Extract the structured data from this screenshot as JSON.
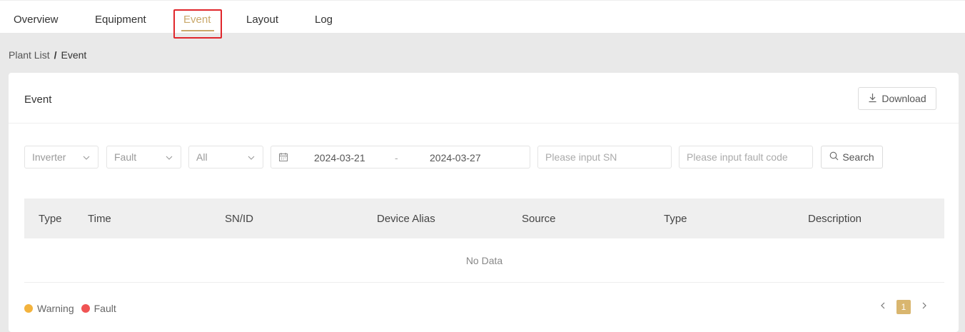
{
  "tabs": [
    {
      "label": "Overview"
    },
    {
      "label": "Equipment"
    },
    {
      "label": "Event"
    },
    {
      "label": "Layout"
    },
    {
      "label": "Log"
    }
  ],
  "breadcrumb": {
    "parent": "Plant List",
    "separator": "/",
    "current": "Event"
  },
  "card": {
    "title": "Event",
    "download_label": "Download"
  },
  "filters": {
    "device_type": "Inverter",
    "event_type": "Fault",
    "scope": "All",
    "date_start": "2024-03-21",
    "date_sep": "-",
    "date_end": "2024-03-27",
    "sn_placeholder": "Please input SN",
    "fault_code_placeholder": "Please input fault code",
    "search_label": "Search"
  },
  "table": {
    "columns": [
      "Type",
      "Time",
      "SN/ID",
      "Device Alias",
      "Source",
      "Type",
      "Description"
    ],
    "empty_text": "No Data"
  },
  "legend": {
    "warning": "Warning",
    "fault": "Fault"
  },
  "pagination": {
    "current_page": "1"
  },
  "colors": {
    "accent": "#c9a86a",
    "warning": "#f3b33d",
    "fault": "#f05454",
    "highlight": "#e0262b"
  },
  "icons": [
    "download-icon",
    "chevron-down-icon",
    "calendar-icon",
    "search-icon",
    "chevron-left-icon",
    "chevron-right-icon"
  ]
}
